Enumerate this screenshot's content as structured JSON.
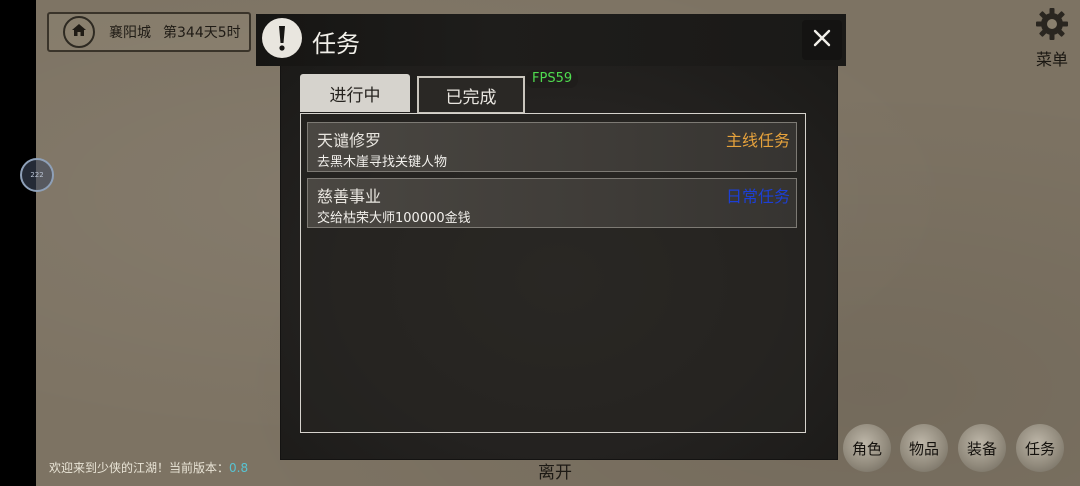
{
  "location": {
    "city": "襄阳城",
    "day_time": "第344天5时",
    "home_icon": "home-icon"
  },
  "side_circle": {
    "label": "222"
  },
  "menu": {
    "label": "菜单",
    "icon": "gear-icon"
  },
  "dialog": {
    "title": "任务",
    "title_icon": "exclamation-icon",
    "close_icon": "close-icon",
    "tabs": [
      {
        "label": "进行中",
        "active": true
      },
      {
        "label": "已完成",
        "active": false
      }
    ],
    "fps": "FPS59",
    "quests": [
      {
        "name": "天谴修罗",
        "type": "主线任务",
        "type_color": "#e6a23c",
        "desc": "去黑木崖寻找关键人物"
      },
      {
        "name": "慈善事业",
        "type": "日常任务",
        "type_color": "#1c3fd6",
        "desc": "交给枯荣大师100000金钱"
      }
    ]
  },
  "leave_label": "离开",
  "welcome": {
    "text": "欢迎来到少侠的江湖！当前版本：",
    "version": "0.8"
  },
  "bottom_buttons": [
    {
      "label": "角色"
    },
    {
      "label": "物品"
    },
    {
      "label": "装备"
    },
    {
      "label": "任务"
    }
  ]
}
